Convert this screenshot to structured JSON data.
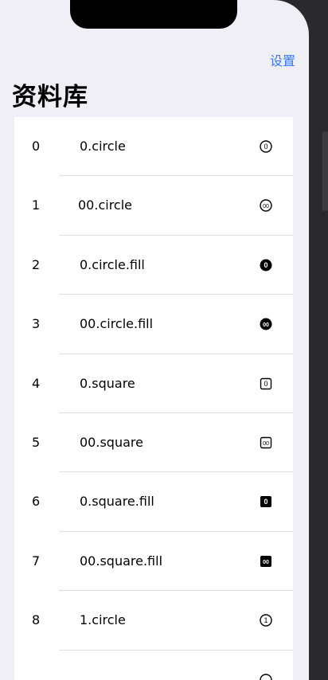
{
  "nav": {
    "right_button": "设置",
    "title": "资料库"
  },
  "rows": [
    {
      "index": "0",
      "name": "0.circle",
      "icon": "0-circle-icon"
    },
    {
      "index": "1",
      "name": "00.circle",
      "icon": "00-circle-icon"
    },
    {
      "index": "2",
      "name": "0.circle.fill",
      "icon": "0-circle-fill-icon"
    },
    {
      "index": "3",
      "name": "00.circle.fill",
      "icon": "00-circle-fill-icon"
    },
    {
      "index": "4",
      "name": "0.square",
      "icon": "0-square-icon"
    },
    {
      "index": "5",
      "name": "00.square",
      "icon": "00-square-icon"
    },
    {
      "index": "6",
      "name": "0.square.fill",
      "icon": "0-square-fill-icon"
    },
    {
      "index": "7",
      "name": "00.square.fill",
      "icon": "00-square-fill-icon"
    },
    {
      "index": "8",
      "name": "1.circle",
      "icon": "1-circle-icon"
    }
  ],
  "colors": {
    "accent": "#3478f6",
    "background": "#f0eff5",
    "separator": "#dedde3"
  }
}
